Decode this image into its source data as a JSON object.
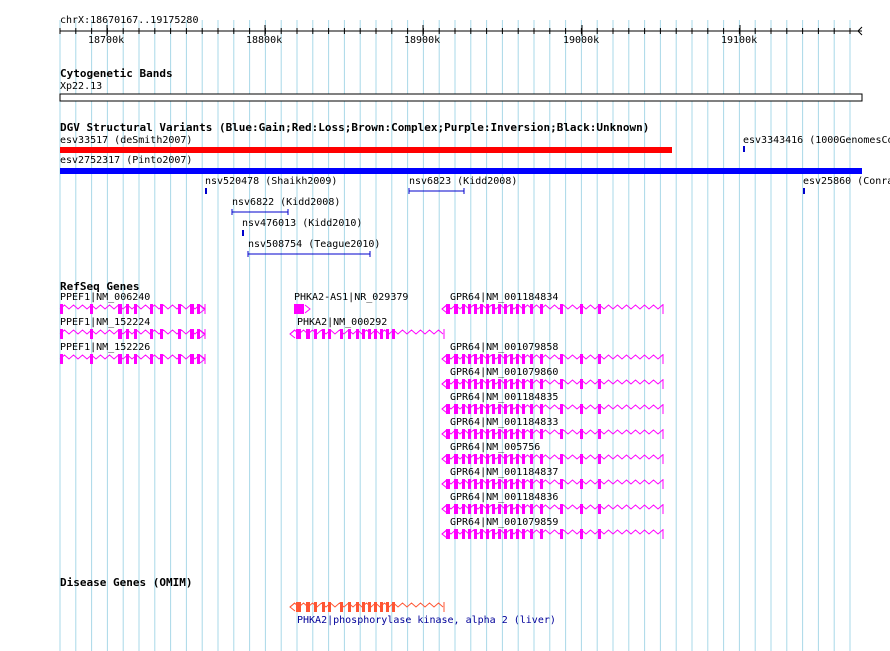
{
  "colors": {
    "grid": "#a9d8e8",
    "variant_loss": "#ff0000",
    "variant_gain": "#0000ff",
    "small_variant": "#0000cc",
    "gene": "#ff00ff",
    "disease_gene": "#ff5533",
    "disease_label": "#000099"
  },
  "ruler": {
    "coords": "chrX:18670167..19175280",
    "ticks": [
      "18700k",
      "18800k",
      "18900k",
      "19000k",
      "19100k"
    ]
  },
  "cytobands": {
    "title": "Cytogenetic Bands",
    "band": "Xp22.13"
  },
  "dgv": {
    "title": "DGV Structural Variants (Blue:Gain;Red:Loss;Brown:Complex;Purple:Inversion;Black:Unknown)",
    "variants": [
      "esv33517 (deSmith2007)",
      "esv3343416 (1000GenomesCo",
      "esv2752317 (Pinto2007)",
      "nsv520478 (Shaikh2009)",
      "nsv6823 (Kidd2008)",
      "esv25860 (Conra",
      "nsv6822 (Kidd2008)",
      "nsv476013 (Kidd2010)",
      "nsv508754 (Teague2010)"
    ]
  },
  "refseq": {
    "title": "RefSeq Genes",
    "genes": [
      "PPEF1|NM_006240",
      "PPEF1|NM_152224",
      "PPEF1|NM_152226",
      "PHKA2-AS1|NR_029379",
      "PHKA2|NM_000292",
      "GPR64|NM_001184834",
      "GPR64|NM_001079858",
      "GPR64|NM_001079860",
      "GPR64|NM_001184835",
      "GPR64|NM_001184833",
      "GPR64|NM_005756",
      "GPR64|NM_001184837",
      "GPR64|NM_001184836",
      "GPR64|NM_001079859"
    ]
  },
  "omim": {
    "title": "Disease Genes (OMIM)",
    "gene_label": "PHKA2|phosphorylase kinase, alpha 2 (liver)"
  }
}
